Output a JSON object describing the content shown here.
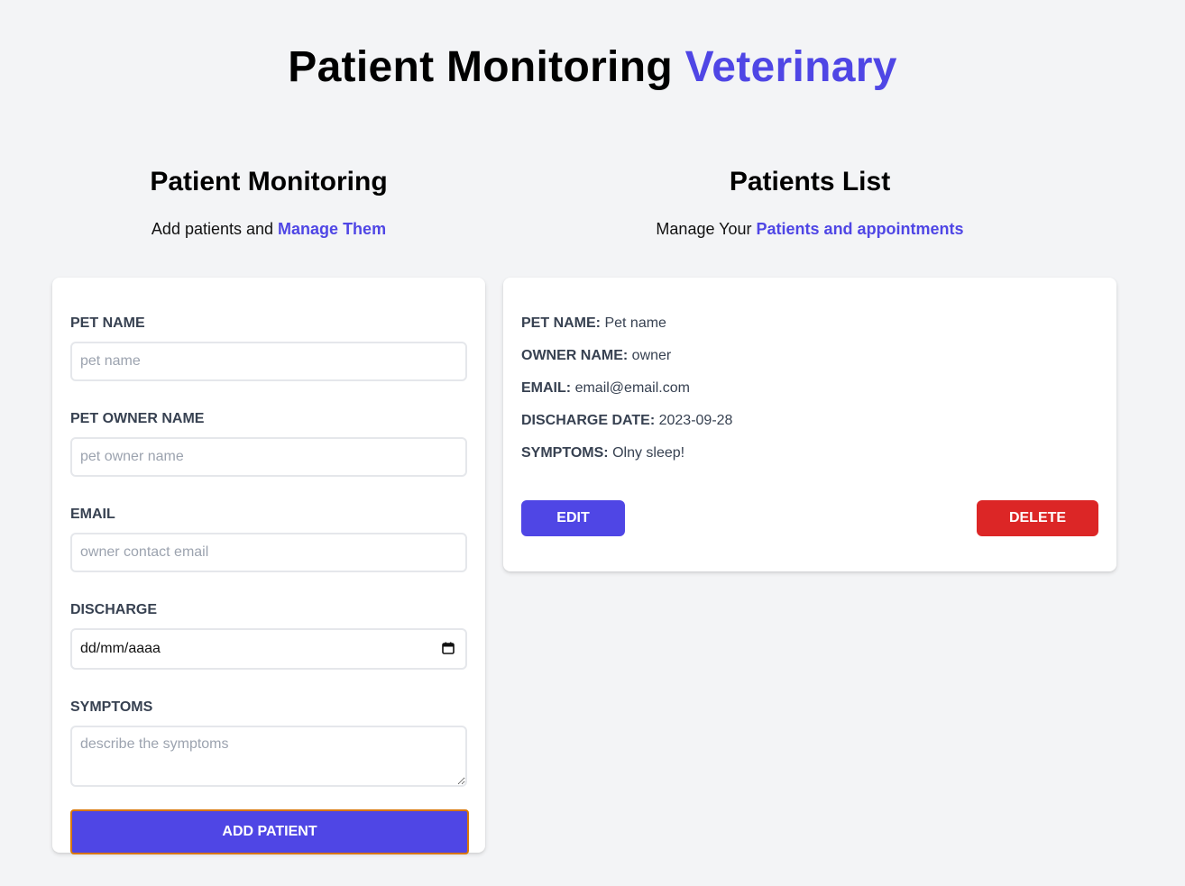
{
  "header": {
    "title_main": "Patient Monitoring",
    "title_accent": "Veterinary"
  },
  "form_section": {
    "heading": "Patient Monitoring",
    "subtitle_text": "Add patients and",
    "subtitle_accent": "Manage Them",
    "fields": {
      "pet_name": {
        "label": "Pet Name",
        "placeholder": "pet name"
      },
      "owner_name": {
        "label": "Pet Owner Name",
        "placeholder": "pet owner name"
      },
      "email": {
        "label": "Email",
        "placeholder": "owner contact email"
      },
      "discharge": {
        "label": "Discharge",
        "value": "dd/mm/aaaa",
        "icon": "calendar-icon"
      },
      "symptoms": {
        "label": "Symptoms",
        "placeholder": "describe the symptoms"
      }
    },
    "submit_label": "Add Patient"
  },
  "list_section": {
    "heading": "Patients List",
    "subtitle_text": "Manage Your",
    "subtitle_accent": "Patients and appointments",
    "patients": [
      {
        "pet_name_key": "Pet Name:",
        "pet_name": "Pet name",
        "owner_key": "Owner Name:",
        "owner": "owner",
        "email_key": "Email:",
        "email": "email@email.com",
        "discharge_key": "Discharge Date:",
        "discharge": "2023-09-28",
        "symptoms_key": "Symptoms:",
        "symptoms": "Olny sleep!",
        "edit_label": "Edit",
        "delete_label": "Delete"
      }
    ]
  },
  "colors": {
    "accent": "#4f46e5",
    "danger": "#dc2626",
    "background": "#f3f4f6",
    "focus_border": "#d97706"
  }
}
